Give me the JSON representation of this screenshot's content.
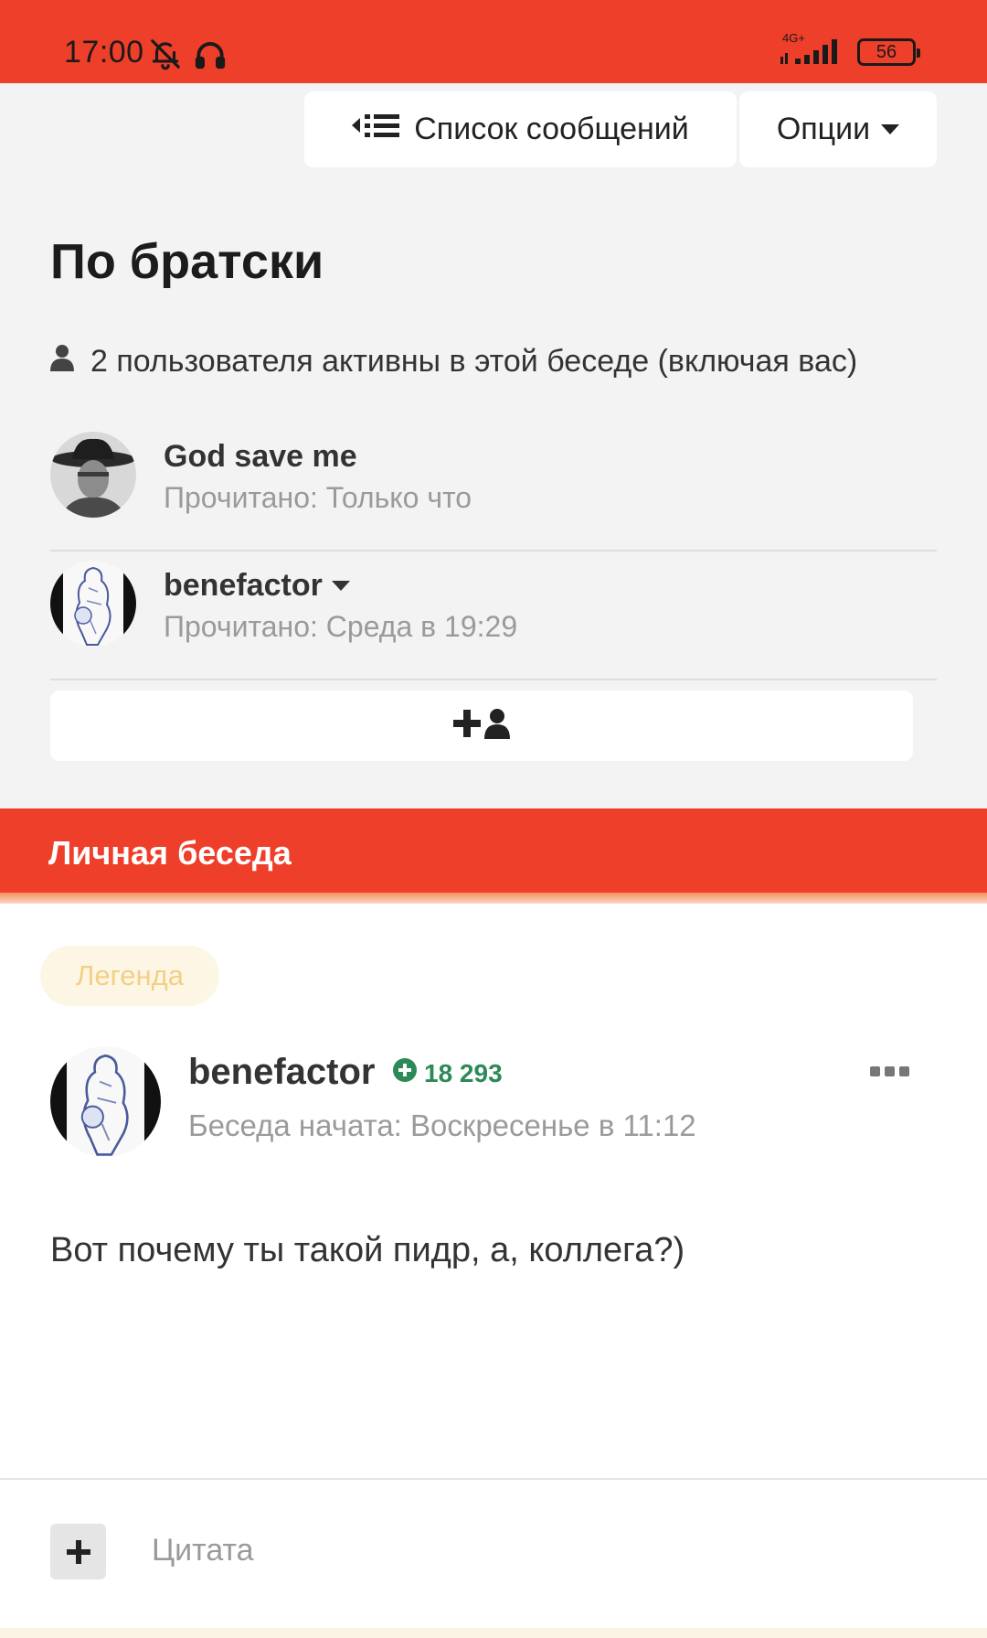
{
  "status_bar": {
    "time": "17:00",
    "network": "4G+",
    "battery": "56",
    "icons": [
      "bell-off-icon",
      "headphones-icon",
      "signal-icon",
      "battery-icon"
    ]
  },
  "top_buttons": {
    "list_label": "Список сообщений",
    "options_label": "Опции"
  },
  "conversation": {
    "title": "По братски",
    "participants_summary": "2 пользователя активны в этой беседе (включая вас)",
    "participants": [
      {
        "name": "God save me",
        "read": "Прочитано: Только что"
      },
      {
        "name": "benefactor",
        "read": "Прочитано: Среда в 19:29"
      }
    ]
  },
  "section": {
    "title": "Личная беседа"
  },
  "message": {
    "badge": "Легенда",
    "author": "benefactor",
    "reputation": "18 293",
    "date": "Беседа начата: Воскресенье в 11:12",
    "body": "Вот почему ты такой пидр, а, коллега?)",
    "quote_label": "Цитата"
  },
  "colors": {
    "accent": "#ee3f2a",
    "reputation": "#2c8a56",
    "badge_text": "#f3cf86"
  }
}
